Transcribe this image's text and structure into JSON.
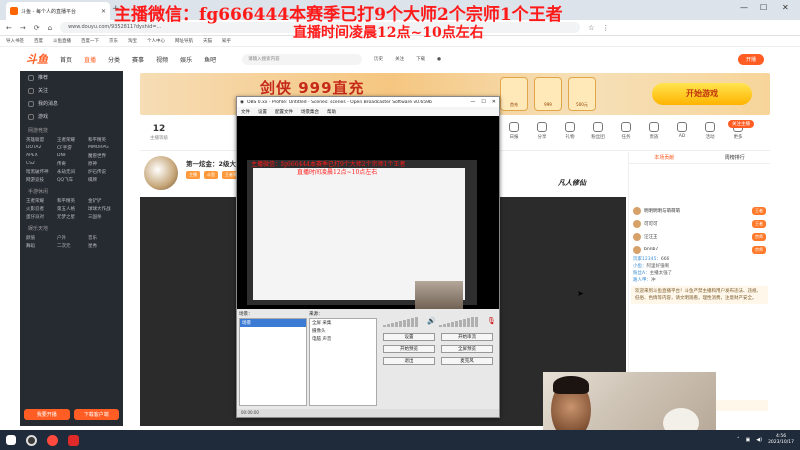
{
  "browser": {
    "tab_title": "斗鱼 - 每个人的直播平台",
    "url": "www.douyu.com/9352811?dyshid=...",
    "bookmarks": [
      "导入书签",
      "百度",
      "斗鱼直播",
      "百度一下",
      "京东",
      "淘宝",
      "个人中心",
      "网址导航",
      "天猫",
      "知乎"
    ]
  },
  "site": {
    "logo": "斗鱼",
    "nav": [
      "首页",
      "直播",
      "分类",
      "赛事",
      "视频",
      "娱乐",
      "鱼吧"
    ],
    "search_placeholder": "请输入搜索内容",
    "header_icons": [
      "历史",
      "关注",
      "下载",
      "开播"
    ],
    "open_btn": "开播"
  },
  "overlay": {
    "line1": "主播微信：fg666444本赛季已打9个大师2个宗师1个王者",
    "line2": "直播时间凌晨12点~10点左右"
  },
  "sidebar": {
    "items": [
      "推荐",
      "关注",
      "我的消息",
      "游戏"
    ],
    "section1": "网游竞技",
    "grid1": [
      "英雄联盟",
      "王者荣耀",
      "和平精英",
      "DOTA2",
      "CF手游",
      "MMORPG",
      "APEX",
      "DNF",
      "魔兽世界",
      "CS2",
      "传奇",
      "原神",
      "暗黑破坏神",
      "永劫无间",
      "炉石传说",
      "网游竞技",
      "QQ飞车",
      "棋牌"
    ],
    "section2": "手游休闲",
    "grid2": [
      "王者荣耀",
      "和平精英",
      "金铲铲",
      "火影忍者",
      "第五人格",
      "球球大作战",
      "蛋仔派对",
      "元梦之星",
      "三国杀"
    ],
    "section3": "娱乐天地",
    "grid3": [
      "颜值",
      "户外",
      "音乐",
      "舞蹈",
      "二次元",
      "星秀"
    ],
    "btn_left": "我要开播",
    "btn_right": "下载客户端"
  },
  "banner": {
    "title": "剑侠 999直充",
    "cta": "开始游戏",
    "badges": [
      "首充",
      "999",
      "500元"
    ]
  },
  "actions": {
    "stat_value": "12",
    "stat_label": "主播等级",
    "items": [
      "日报",
      "分享",
      "礼物",
      "粉丝团",
      "任务",
      "贵族",
      "AD",
      "活动",
      "更多"
    ],
    "follow_btn": "关注主播"
  },
  "room": {
    "title": "第一炫金：2级大师后排核心...",
    "tags": [
      "主播",
      "斗鱼",
      "王者荣耀"
    ],
    "brand": "凡人修仙"
  },
  "rightcol": {
    "tabs": [
      "本场贡献",
      "周榜排行"
    ],
    "ranks": [
      {
        "name": "明明明明与萌萌萌",
        "badge": "王者"
      },
      {
        "name": "可可可",
        "badge": "王者"
      },
      {
        "name": "汪汪王",
        "badge": "宗师"
      },
      {
        "name": "bnnb7",
        "badge": "宗师"
      }
    ],
    "chats": [
      {
        "user": "玩家12345：",
        "text": "666"
      },
      {
        "user": "小鱼：",
        "text": "阿里好强啊"
      },
      {
        "user": "粉丝A：",
        "text": "主播太强了"
      },
      {
        "user": "路人甲：",
        "text": "冲"
      }
    ],
    "notice": "欢迎来到斗鱼直播平台！斗鱼严禁主播和用户发布违法、违规、低俗、色情等内容，请文明观看，理性消费，注意财产安全。",
    "notice2": "东东东东东东：（小熊亚亚）（可可）"
  },
  "obs": {
    "title": "OBS 0.xx - Profile: Untitled - Scenes: scenes - Open Broadcaster Software v0.659b",
    "menu": [
      "文件",
      "设置",
      "配置文件",
      "场景集合",
      "帮助"
    ],
    "scenes_label": "场景：",
    "sources_label": "来源：",
    "scene_item": "场景",
    "sources": [
      "全屏 采集",
      "摄像头",
      "电脑 声音"
    ],
    "buttons": [
      "设置",
      "开始串流",
      "开始预览",
      "全屏预览",
      "退出",
      "麦克风"
    ],
    "status": "00:00:00"
  },
  "taskbar": {
    "time": "4:56",
    "date": "2023/10/17"
  }
}
